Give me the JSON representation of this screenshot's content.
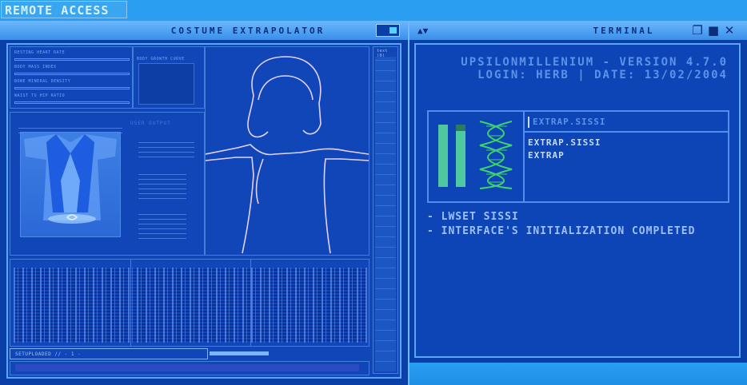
{
  "app": {
    "remote_access": "REMOTE ACCESS"
  },
  "left_window": {
    "title": "COSTUME EXTRAPOLATOR",
    "stats": [
      "RESTING HEART RATE",
      "BODY MASS INDEX",
      "BONE MINERAL DENSITY",
      "WAIST TO HIP RATIO"
    ],
    "growth_curve": "BODY GROWTH CURVE",
    "user_output": "USER OUTPUT",
    "side_label": "text (0)",
    "footer_label": "SETUPLOADED // - 1 -"
  },
  "right_window": {
    "title": "TERMINAL",
    "version": "UPSILONMILLENIUM - VERSION 4.7.0",
    "login": "LOGIN: HERB | DATE: 13/02/2004",
    "input": "EXTRAP.SISSI",
    "output": [
      "EXTRAP.SISSI",
      "EXTRAP"
    ],
    "messages": [
      "- LWSET SISSI",
      "- INTERFACE'S INITIALIZATION COMPLETED"
    ]
  },
  "icons": {
    "sort": "up-down-arrows-icon",
    "restore": "restore-icon",
    "maximize": "maximize-icon",
    "close": "close-icon"
  },
  "colors": {
    "background": "#1f8fe6",
    "window": "#0b3fa8",
    "accent": "#5aa6ff",
    "dna": "#3ed36b"
  }
}
